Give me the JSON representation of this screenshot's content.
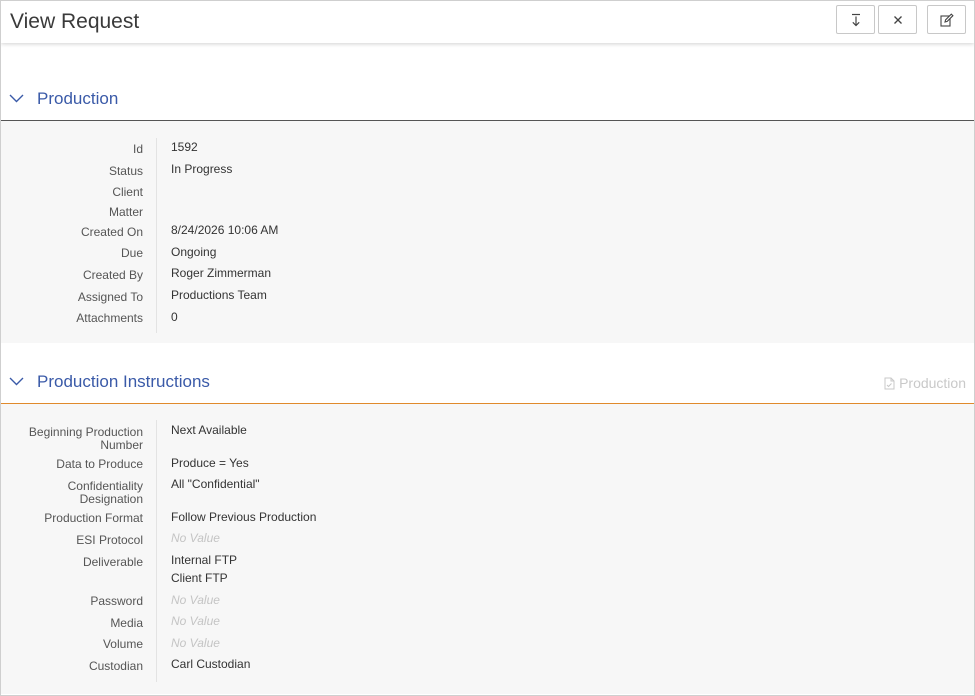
{
  "header": {
    "title": "View Request",
    "buttons": [
      {
        "icon": "download-icon"
      },
      {
        "icon": "close-icon"
      },
      {
        "icon": "edit-icon"
      }
    ]
  },
  "production": {
    "title": "Production",
    "fields": [
      {
        "label": "Id",
        "value": "1592"
      },
      {
        "label": "Status",
        "value": "In Progress"
      },
      {
        "label": "Client",
        "value": ""
      },
      {
        "label": "Matter",
        "value": ""
      },
      {
        "label": "Created On",
        "value": "8/24/2026 10:06 AM"
      },
      {
        "label": "Due",
        "value": "Ongoing"
      },
      {
        "label": "Created By",
        "value": "Roger Zimmerman"
      },
      {
        "label": "Assigned To",
        "value": "Productions Team"
      },
      {
        "label": "Attachments",
        "value": "0"
      }
    ]
  },
  "instructions": {
    "title": "Production Instructions",
    "link_label": "Production",
    "fields": [
      {
        "label": "Beginning Production Number",
        "value": "Next Available"
      },
      {
        "label": "Data to Produce",
        "value": "Produce = Yes"
      },
      {
        "label": "Confidentiality Designation",
        "value": "All \"Confidential\""
      },
      {
        "label": "Production Format",
        "value": "Follow Previous Production"
      },
      {
        "label": "ESI Protocol",
        "value": "No Value"
      },
      {
        "label": "Deliverable",
        "value": "Internal FTP",
        "value2": "Client FTP"
      },
      {
        "label": "Password",
        "value": "No Value"
      },
      {
        "label": "Media",
        "value": "No Value"
      },
      {
        "label": "Volume",
        "value": "No Value"
      },
      {
        "label": "Custodian",
        "value": "Carl Custodian"
      }
    ]
  },
  "colors": {
    "accent": "#3a5aa8",
    "production_rule": "#555555",
    "instructions_rule": "#e08a2c",
    "muted": "#c4c4c4"
  }
}
